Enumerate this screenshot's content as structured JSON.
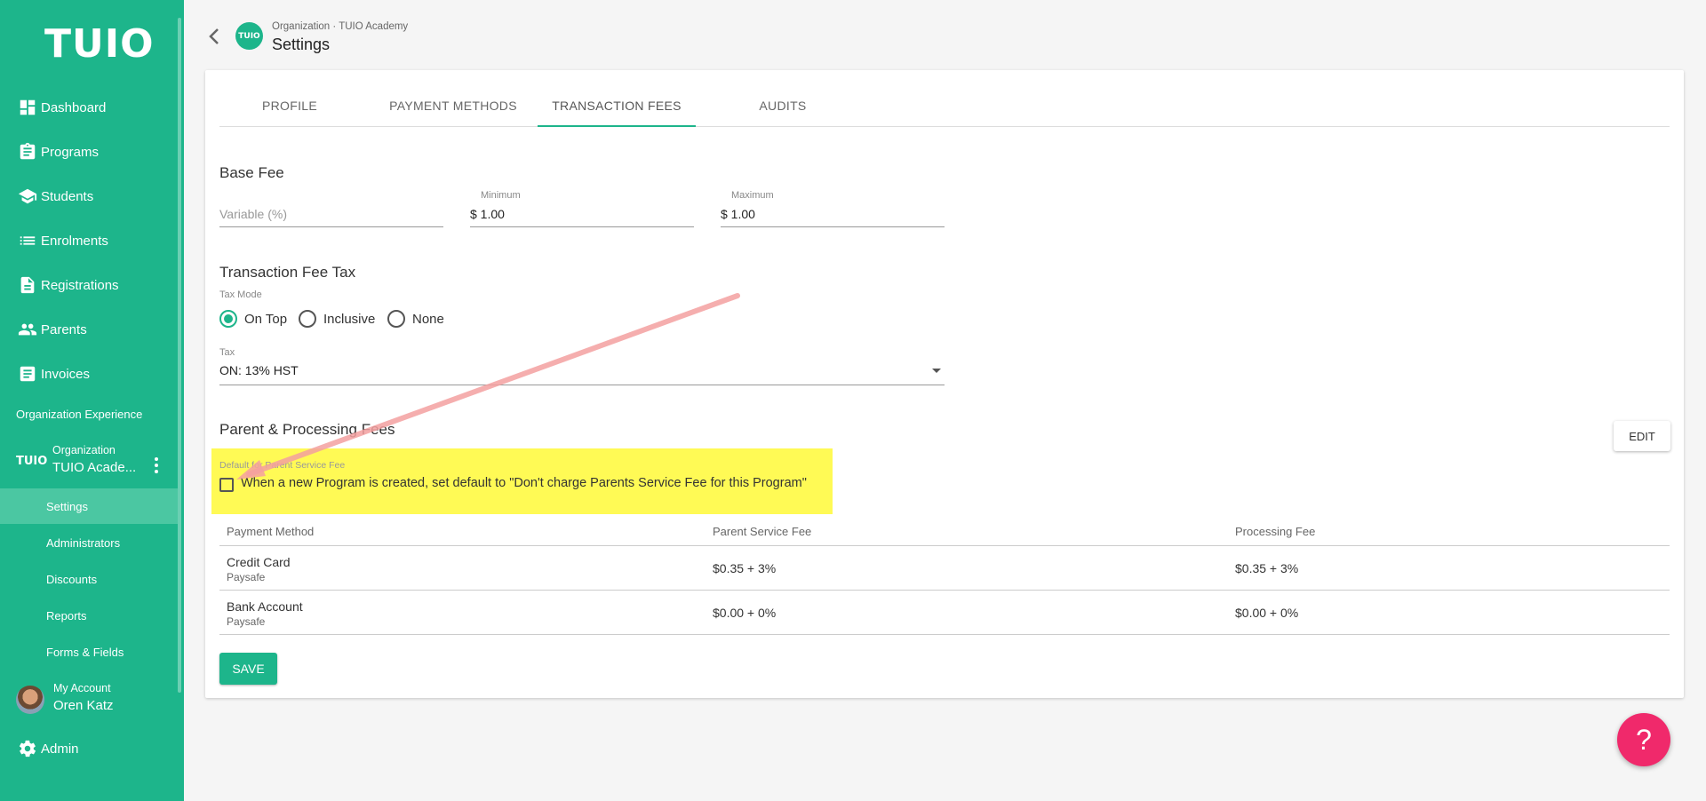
{
  "sidebar": {
    "logo": "TUIO",
    "nav": [
      {
        "label": "Dashboard",
        "icon": "dashboard-icon"
      },
      {
        "label": "Programs",
        "icon": "clipboard-icon"
      },
      {
        "label": "Students",
        "icon": "school-icon"
      },
      {
        "label": "Enrolments",
        "icon": "list-icon"
      },
      {
        "label": "Registrations",
        "icon": "document-icon"
      },
      {
        "label": "Parents",
        "icon": "people-icon"
      },
      {
        "label": "Invoices",
        "icon": "receipt-icon"
      }
    ],
    "section_label": "Organization Experience",
    "org": {
      "logo": "TUIO",
      "label": "Organization",
      "name": "TUIO Acade..."
    },
    "sub_items": [
      "Settings",
      "Administrators",
      "Discounts",
      "Reports",
      "Forms & Fields"
    ],
    "account": {
      "label": "My Account",
      "name": "Oren Katz"
    },
    "admin": {
      "label": "Admin",
      "icon": "gear-icon"
    }
  },
  "header": {
    "logo": "TUIO",
    "breadcrumb": "Organization · TUIO Academy",
    "title": "Settings"
  },
  "tabs": [
    {
      "label": "PROFILE",
      "active": false
    },
    {
      "label": "PAYMENT METHODS",
      "active": false
    },
    {
      "label": "TRANSACTION FEES",
      "active": true
    },
    {
      "label": "AUDITS",
      "active": false
    }
  ],
  "base_fee": {
    "title": "Base Fee",
    "variable_placeholder": "Variable (%)",
    "minimum_label": "Minimum",
    "minimum_value": "$ 1.00",
    "maximum_label": "Maximum",
    "maximum_value": "$ 1.00"
  },
  "tax": {
    "title": "Transaction Fee Tax",
    "mode_label": "Tax Mode",
    "modes": [
      {
        "label": "On Top",
        "selected": true
      },
      {
        "label": "Inclusive",
        "selected": false
      },
      {
        "label": "None",
        "selected": false
      }
    ],
    "tax_label": "Tax",
    "tax_value": "ON: 13% HST"
  },
  "fees": {
    "title": "Parent & Processing Fees",
    "edit_label": "EDIT",
    "default_label": "Default for Parent Service Fee",
    "checkbox_text": "When a new Program is created, set default to \"Don't charge Parents Service Fee for this Program\"",
    "checkbox_checked": false,
    "columns": [
      "Payment Method",
      "Parent Service Fee",
      "Processing Fee"
    ],
    "rows": [
      {
        "method": "Credit Card",
        "provider": "Paysafe",
        "parent_fee": "$0.35 + 3%",
        "processing_fee": "$0.35 + 3%"
      },
      {
        "method": "Bank Account",
        "provider": "Paysafe",
        "parent_fee": "$0.00 + 0%",
        "processing_fee": "$0.00 + 0%"
      }
    ]
  },
  "save_label": "SAVE",
  "help_label": "?",
  "colors": {
    "brand": "#1db58b",
    "highlight": "#fffa55",
    "help": "#f0296b",
    "annotation_arrow": "#f4a0a0"
  }
}
